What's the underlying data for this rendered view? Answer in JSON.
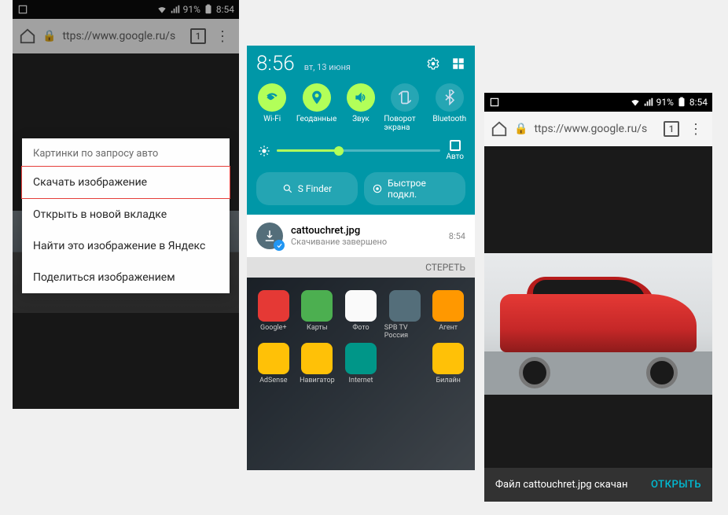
{
  "status": {
    "battery": "91%",
    "time": "8:54"
  },
  "address": {
    "url": "ttps://www.google.ru/s",
    "tab_count": "1"
  },
  "phone1": {
    "context_header": "Картинки по запросу авто",
    "items": [
      "Скачать изображение",
      "Открыть в новой вкладке",
      "Найти это изображение в Яндекс",
      "Поделиться изображением"
    ]
  },
  "phone2": {
    "qs_time": "8:56",
    "qs_date": "вт, 13 июня",
    "toggles": [
      {
        "label": "Wi-Fi",
        "on": true
      },
      {
        "label": "Геоданные",
        "on": true
      },
      {
        "label": "Звук",
        "on": true
      },
      {
        "label": "Поворот экрана",
        "on": false
      },
      {
        "label": "Bluetooth",
        "on": false
      }
    ],
    "auto_label": "Авто",
    "sfinder": "S Finder",
    "quickconn": "Быстрое подкл.",
    "notif_title": "cattouchret.jpg",
    "notif_sub": "Скачивание завершено",
    "notif_time": "8:54",
    "clear": "СТЕРЕТЬ",
    "apps_row1": [
      "Google+",
      "Карты",
      "Фото",
      "SPB TV Россия",
      "Агент"
    ],
    "apps_row2": [
      "AdSense",
      "Навигатор",
      "Internet",
      "",
      "Билайн"
    ]
  },
  "phone3": {
    "snackbar_text": "Файл cattouchret.jpg скачан",
    "snackbar_action": "ОТКРЫТЬ"
  }
}
